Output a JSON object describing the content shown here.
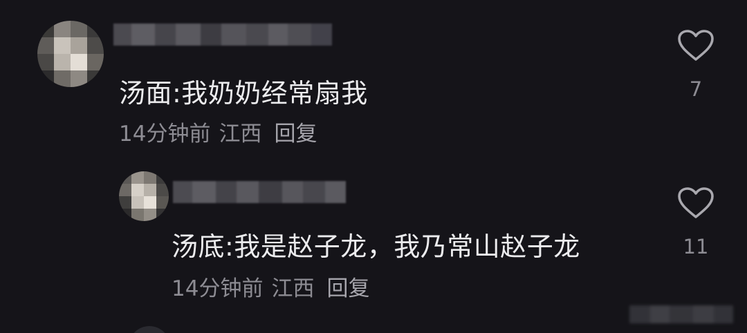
{
  "background_color": "#151419",
  "comments": [
    {
      "text": "汤面:我奶奶经常扇我",
      "time": "14分钟前",
      "location": "江西",
      "reply_label": "回复",
      "like_count": "7",
      "like_icon": "heart-outline-icon",
      "avatar_icon": "blurred-avatar-icon",
      "username_blurred": true
    },
    {
      "text": "汤底:我是赵子龙，我乃常山赵子龙",
      "time": "14分钟前",
      "location": "江西",
      "reply_label": "回复",
      "like_count": "11",
      "like_icon": "heart-outline-icon",
      "avatar_icon": "blurred-avatar-icon",
      "username_blurred": true,
      "is_reply": true
    }
  ],
  "colors": {
    "text_primary": "#ECECEE",
    "text_secondary": "#8D8C93",
    "icon": "#A9A8AE"
  }
}
